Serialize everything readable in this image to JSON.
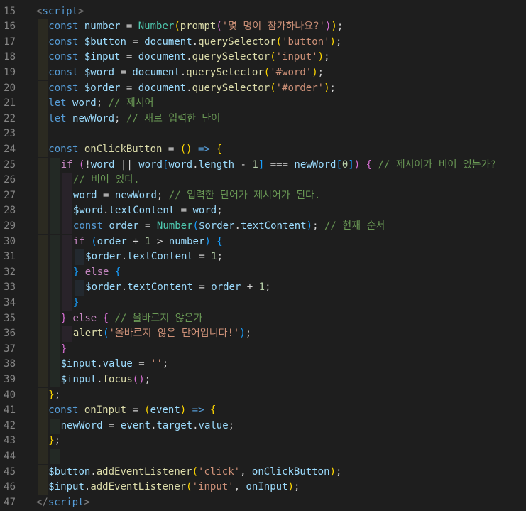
{
  "editor": {
    "lines": [
      {
        "n": "15",
        "indent": 0,
        "tokens": [
          [
            "tag",
            "<"
          ],
          [
            "tagname",
            "script"
          ],
          [
            "tag",
            ">"
          ]
        ]
      },
      {
        "n": "16",
        "indent": 1,
        "tokens": [
          [
            "kw",
            "const "
          ],
          [
            "var",
            "number"
          ],
          [
            "op",
            " = "
          ],
          [
            "cls",
            "Number"
          ],
          [
            "b1",
            "("
          ],
          [
            "fn",
            "prompt"
          ],
          [
            "b2",
            "("
          ],
          [
            "str",
            "'몇 명이 참가하나요?'"
          ],
          [
            "b2",
            ")"
          ],
          [
            "b1",
            ")"
          ],
          [
            "pun",
            ";"
          ]
        ]
      },
      {
        "n": "17",
        "indent": 1,
        "tokens": [
          [
            "kw",
            "const "
          ],
          [
            "var",
            "$button"
          ],
          [
            "op",
            " = "
          ],
          [
            "var",
            "document"
          ],
          [
            "pun",
            "."
          ],
          [
            "fn",
            "querySelector"
          ],
          [
            "b1",
            "("
          ],
          [
            "str",
            "'button'"
          ],
          [
            "b1",
            ")"
          ],
          [
            "pun",
            ";"
          ]
        ]
      },
      {
        "n": "18",
        "indent": 1,
        "tokens": [
          [
            "kw",
            "const "
          ],
          [
            "var",
            "$input"
          ],
          [
            "op",
            " = "
          ],
          [
            "var",
            "document"
          ],
          [
            "pun",
            "."
          ],
          [
            "fn",
            "querySelector"
          ],
          [
            "b1",
            "("
          ],
          [
            "str",
            "'input'"
          ],
          [
            "b1",
            ")"
          ],
          [
            "pun",
            ";"
          ]
        ]
      },
      {
        "n": "19",
        "indent": 1,
        "tokens": [
          [
            "kw",
            "const "
          ],
          [
            "var",
            "$word"
          ],
          [
            "op",
            " = "
          ],
          [
            "var",
            "document"
          ],
          [
            "pun",
            "."
          ],
          [
            "fn",
            "querySelector"
          ],
          [
            "b1",
            "("
          ],
          [
            "str",
            "'#word'"
          ],
          [
            "b1",
            ")"
          ],
          [
            "pun",
            ";"
          ]
        ]
      },
      {
        "n": "20",
        "indent": 1,
        "tokens": [
          [
            "kw",
            "const "
          ],
          [
            "var",
            "$order"
          ],
          [
            "op",
            " = "
          ],
          [
            "var",
            "document"
          ],
          [
            "pun",
            "."
          ],
          [
            "fn",
            "querySelector"
          ],
          [
            "b1",
            "("
          ],
          [
            "str",
            "'#order'"
          ],
          [
            "b1",
            ")"
          ],
          [
            "pun",
            ";"
          ]
        ]
      },
      {
        "n": "21",
        "indent": 1,
        "tokens": [
          [
            "kw",
            "let "
          ],
          [
            "var",
            "word"
          ],
          [
            "pun",
            "; "
          ],
          [
            "com",
            "// 제시어"
          ]
        ]
      },
      {
        "n": "22",
        "indent": 1,
        "tokens": [
          [
            "kw",
            "let "
          ],
          [
            "var",
            "newWord"
          ],
          [
            "pun",
            "; "
          ],
          [
            "com",
            "// 새로 입력한 단어"
          ]
        ]
      },
      {
        "n": "23",
        "indent": 1,
        "tokens": []
      },
      {
        "n": "24",
        "indent": 1,
        "tokens": [
          [
            "kw",
            "const "
          ],
          [
            "fn",
            "onClickButton"
          ],
          [
            "op",
            " = "
          ],
          [
            "b1",
            "()"
          ],
          [
            "kw",
            " => "
          ],
          [
            "b1",
            "{"
          ]
        ]
      },
      {
        "n": "25",
        "indent": 2,
        "tokens": [
          [
            "ctrl",
            "if "
          ],
          [
            "b2",
            "("
          ],
          [
            "op",
            "!"
          ],
          [
            "var",
            "word"
          ],
          [
            "op",
            " || "
          ],
          [
            "var",
            "word"
          ],
          [
            "b3",
            "["
          ],
          [
            "var",
            "word"
          ],
          [
            "pun",
            "."
          ],
          [
            "var",
            "length"
          ],
          [
            "op",
            " - "
          ],
          [
            "num",
            "1"
          ],
          [
            "b3",
            "]"
          ],
          [
            "op",
            " === "
          ],
          [
            "var",
            "newWord"
          ],
          [
            "b3",
            "["
          ],
          [
            "num",
            "0"
          ],
          [
            "b3",
            "]"
          ],
          [
            "b2",
            ")"
          ],
          [
            "pun",
            " "
          ],
          [
            "b2",
            "{"
          ],
          [
            "com",
            " // 제시어가 비어 있는가?"
          ]
        ]
      },
      {
        "n": "26",
        "indent": 3,
        "tokens": [
          [
            "com",
            "// 비어 있다."
          ]
        ]
      },
      {
        "n": "27",
        "indent": 3,
        "tokens": [
          [
            "var",
            "word"
          ],
          [
            "op",
            " = "
          ],
          [
            "var",
            "newWord"
          ],
          [
            "pun",
            "; "
          ],
          [
            "com",
            "// 입력한 단어가 제시어가 된다."
          ]
        ]
      },
      {
        "n": "28",
        "indent": 3,
        "tokens": [
          [
            "var",
            "$word"
          ],
          [
            "pun",
            "."
          ],
          [
            "var",
            "textContent"
          ],
          [
            "op",
            " = "
          ],
          [
            "var",
            "word"
          ],
          [
            "pun",
            ";"
          ]
        ]
      },
      {
        "n": "29",
        "indent": 3,
        "tokens": [
          [
            "kw",
            "const "
          ],
          [
            "var",
            "order"
          ],
          [
            "op",
            " = "
          ],
          [
            "cls",
            "Number"
          ],
          [
            "b3",
            "("
          ],
          [
            "var",
            "$order"
          ],
          [
            "pun",
            "."
          ],
          [
            "var",
            "textContent"
          ],
          [
            "b3",
            ")"
          ],
          [
            "pun",
            "; "
          ],
          [
            "com",
            "// 현재 순서"
          ]
        ]
      },
      {
        "n": "30",
        "indent": 3,
        "tokens": [
          [
            "ctrl",
            "if "
          ],
          [
            "b3",
            "("
          ],
          [
            "var",
            "order"
          ],
          [
            "op",
            " + "
          ],
          [
            "num",
            "1"
          ],
          [
            "op",
            " > "
          ],
          [
            "var",
            "number"
          ],
          [
            "b3",
            ")"
          ],
          [
            "pun",
            " "
          ],
          [
            "b3",
            "{"
          ]
        ]
      },
      {
        "n": "31",
        "indent": 4,
        "tokens": [
          [
            "var",
            "$order"
          ],
          [
            "pun",
            "."
          ],
          [
            "var",
            "textContent"
          ],
          [
            "op",
            " = "
          ],
          [
            "num",
            "1"
          ],
          [
            "pun",
            ";"
          ]
        ]
      },
      {
        "n": "32",
        "indent": 3,
        "tokens": [
          [
            "b3",
            "}"
          ],
          [
            "ctrl",
            " else "
          ],
          [
            "b3",
            "{"
          ]
        ]
      },
      {
        "n": "33",
        "indent": 4,
        "tokens": [
          [
            "var",
            "$order"
          ],
          [
            "pun",
            "."
          ],
          [
            "var",
            "textContent"
          ],
          [
            "op",
            " = "
          ],
          [
            "var",
            "order"
          ],
          [
            "op",
            " + "
          ],
          [
            "num",
            "1"
          ],
          [
            "pun",
            ";"
          ]
        ]
      },
      {
        "n": "34",
        "indent": 3,
        "tokens": [
          [
            "b3",
            "}"
          ]
        ]
      },
      {
        "n": "35",
        "indent": 2,
        "tokens": [
          [
            "b2",
            "}"
          ],
          [
            "ctrl",
            " else "
          ],
          [
            "b2",
            "{"
          ],
          [
            "com",
            " // 올바르지 않은가"
          ]
        ]
      },
      {
        "n": "36",
        "indent": 3,
        "tokens": [
          [
            "fn",
            "alert"
          ],
          [
            "b3",
            "("
          ],
          [
            "str",
            "'올바르지 않은 단어입니다!'"
          ],
          [
            "b3",
            ")"
          ],
          [
            "pun",
            ";"
          ]
        ]
      },
      {
        "n": "37",
        "indent": 2,
        "tokens": [
          [
            "b2",
            "}"
          ]
        ]
      },
      {
        "n": "38",
        "indent": 2,
        "tokens": [
          [
            "var",
            "$input"
          ],
          [
            "pun",
            "."
          ],
          [
            "var",
            "value"
          ],
          [
            "op",
            " = "
          ],
          [
            "str",
            "''"
          ],
          [
            "pun",
            ";"
          ]
        ]
      },
      {
        "n": "39",
        "indent": 2,
        "tokens": [
          [
            "var",
            "$input"
          ],
          [
            "pun",
            "."
          ],
          [
            "fn",
            "focus"
          ],
          [
            "b2",
            "()"
          ],
          [
            "pun",
            ";"
          ]
        ]
      },
      {
        "n": "40",
        "indent": 1,
        "tokens": [
          [
            "b1",
            "}"
          ],
          [
            "pun",
            ";"
          ]
        ]
      },
      {
        "n": "41",
        "indent": 1,
        "tokens": [
          [
            "kw",
            "const "
          ],
          [
            "fn",
            "onInput"
          ],
          [
            "op",
            " = "
          ],
          [
            "b1",
            "("
          ],
          [
            "var",
            "event"
          ],
          [
            "b1",
            ")"
          ],
          [
            "kw",
            " => "
          ],
          [
            "b1",
            "{"
          ]
        ]
      },
      {
        "n": "42",
        "indent": 2,
        "tokens": [
          [
            "var",
            "newWord"
          ],
          [
            "op",
            " = "
          ],
          [
            "var",
            "event"
          ],
          [
            "pun",
            "."
          ],
          [
            "var",
            "target"
          ],
          [
            "pun",
            "."
          ],
          [
            "var",
            "value"
          ],
          [
            "pun",
            ";"
          ]
        ]
      },
      {
        "n": "43",
        "indent": 1,
        "tokens": [
          [
            "b1",
            "}"
          ],
          [
            "pun",
            ";"
          ]
        ]
      },
      {
        "n": "44",
        "indent": 2,
        "tokens": []
      },
      {
        "n": "45",
        "indent": 1,
        "tokens": [
          [
            "var",
            "$button"
          ],
          [
            "pun",
            "."
          ],
          [
            "fn",
            "addEventListener"
          ],
          [
            "b1",
            "("
          ],
          [
            "str",
            "'click'"
          ],
          [
            "pun",
            ", "
          ],
          [
            "var",
            "onClickButton"
          ],
          [
            "b1",
            ")"
          ],
          [
            "pun",
            ";"
          ]
        ]
      },
      {
        "n": "46",
        "indent": 1,
        "tokens": [
          [
            "var",
            "$input"
          ],
          [
            "pun",
            "."
          ],
          [
            "fn",
            "addEventListener"
          ],
          [
            "b1",
            "("
          ],
          [
            "str",
            "'input'"
          ],
          [
            "pun",
            ", "
          ],
          [
            "var",
            "onInput"
          ],
          [
            "b1",
            ")"
          ],
          [
            "pun",
            ";"
          ]
        ]
      },
      {
        "n": "47",
        "indent": 0,
        "tokens": [
          [
            "tag",
            "</"
          ],
          [
            "tagname",
            "script"
          ],
          [
            "tag",
            ">"
          ]
        ]
      }
    ]
  }
}
